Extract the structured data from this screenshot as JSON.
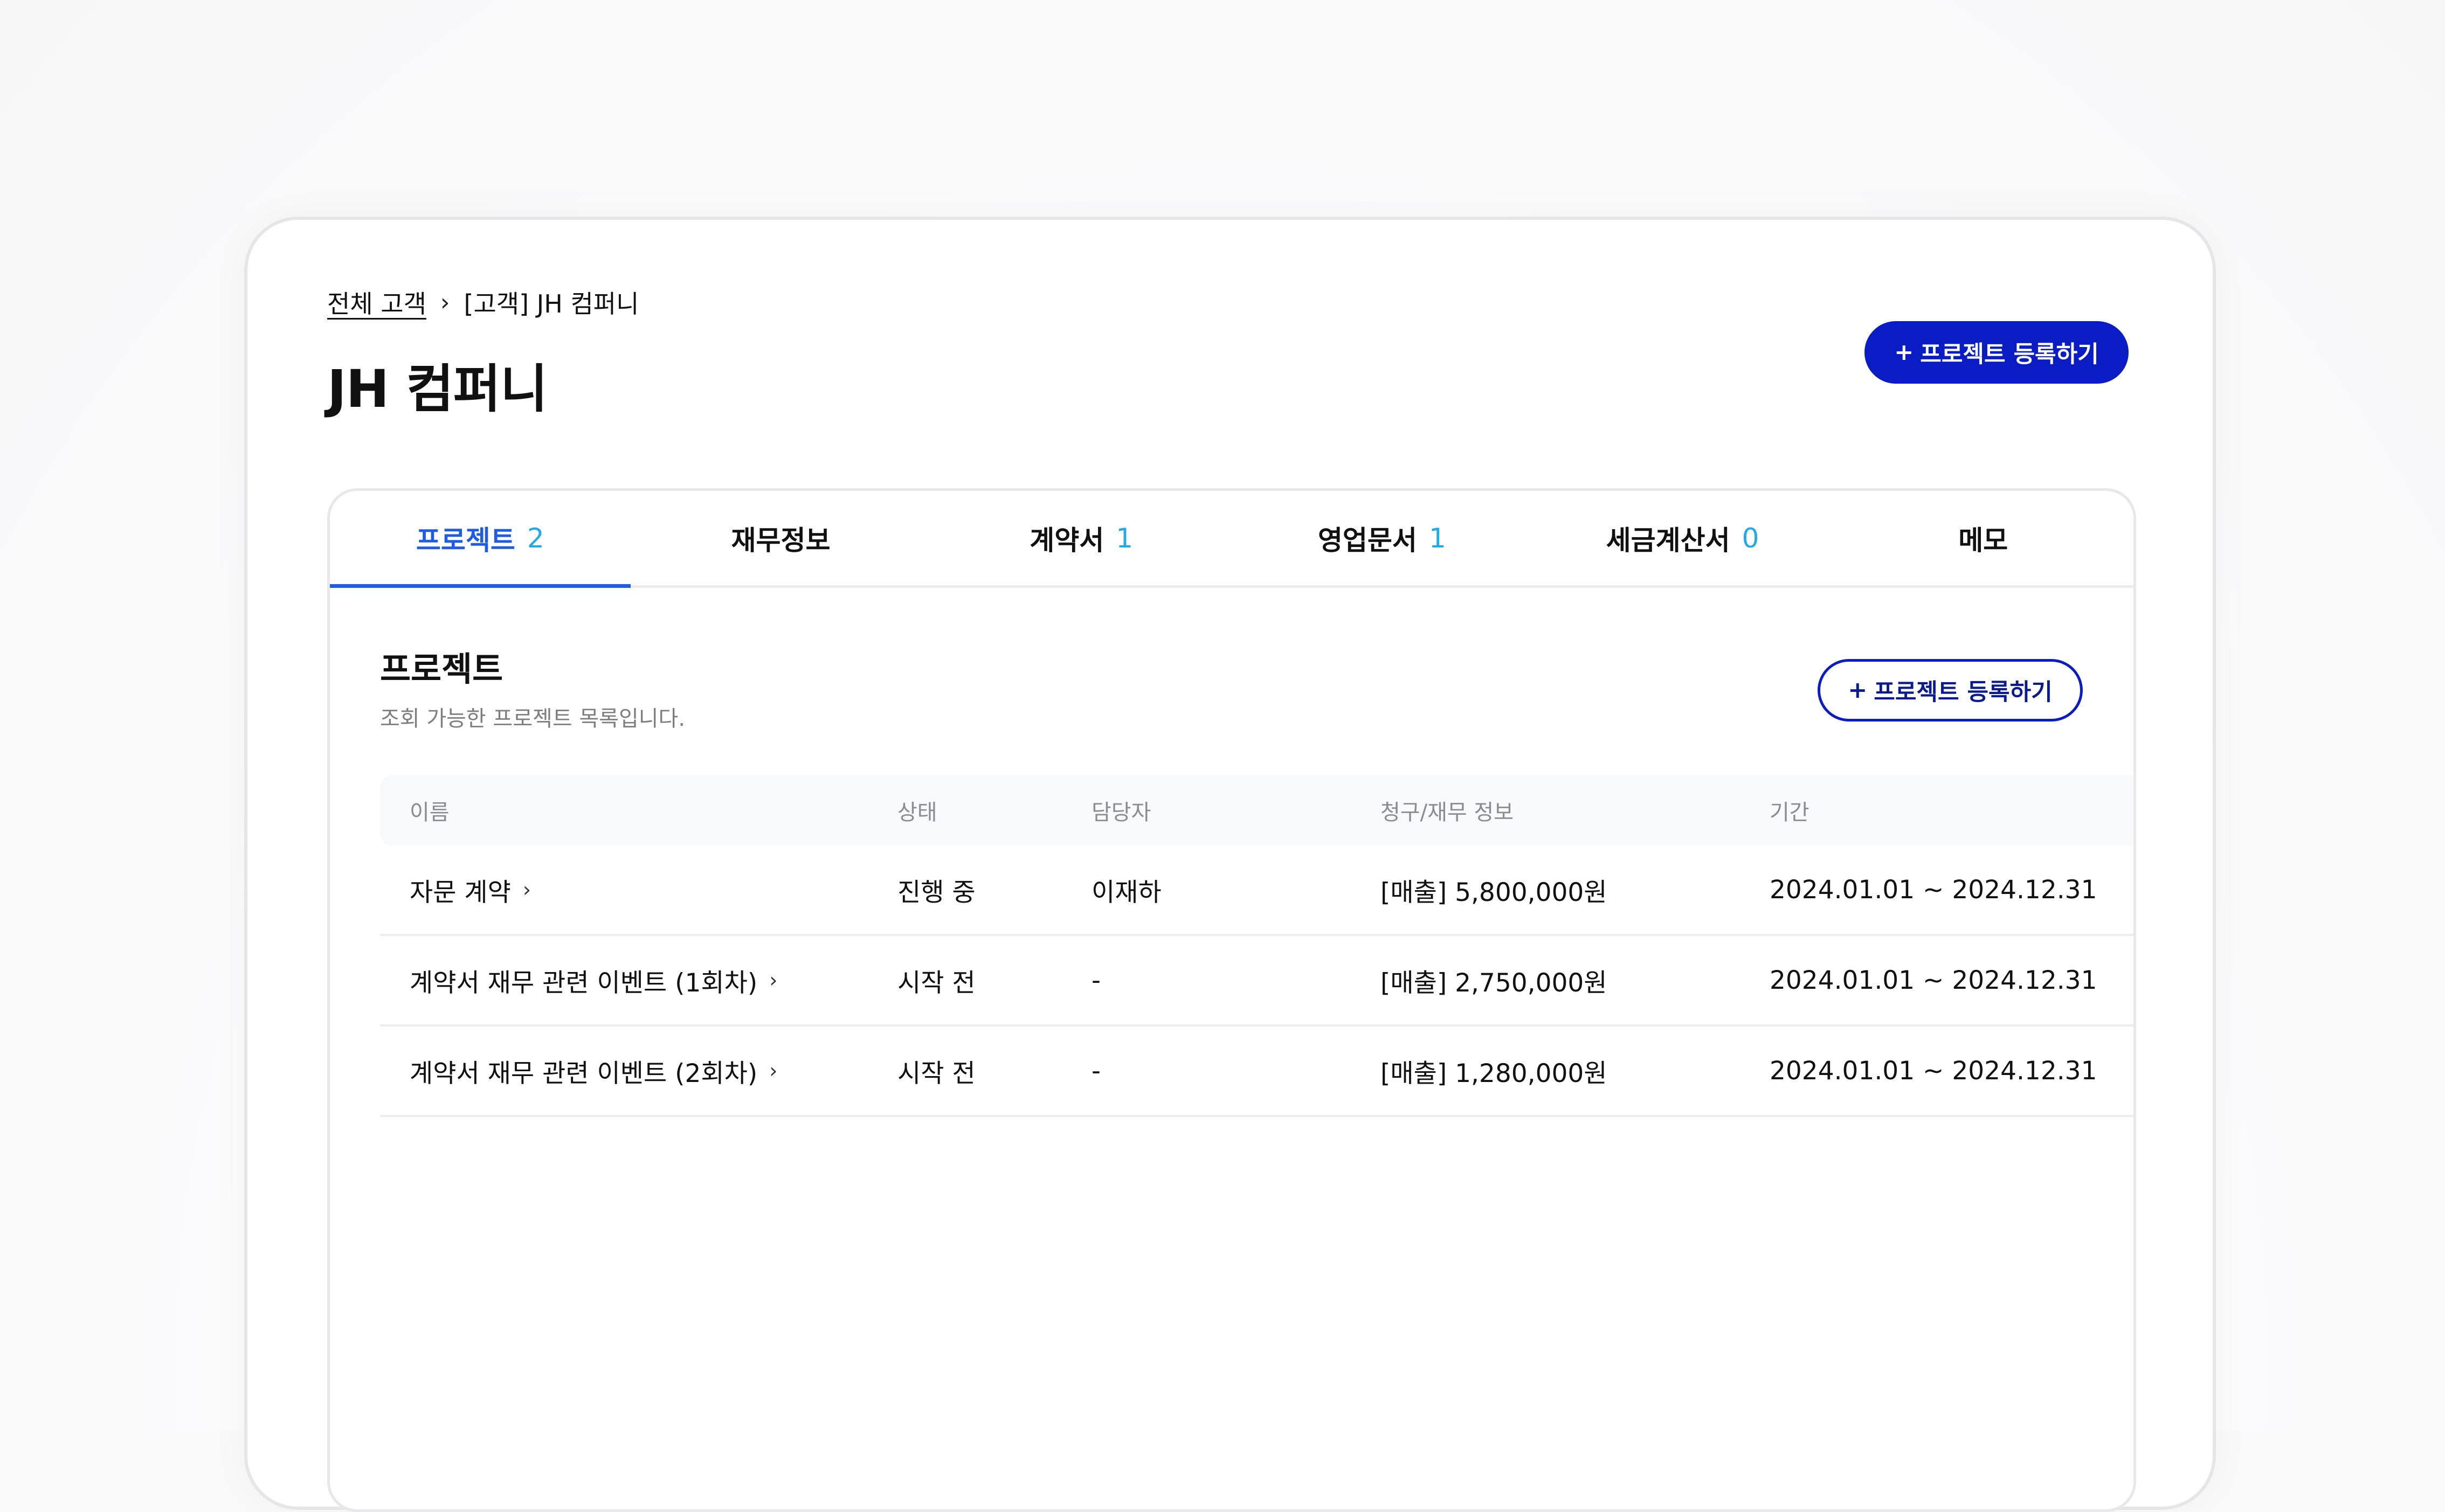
{
  "breadcrumb": {
    "parent": "전체 고객",
    "separator": "›",
    "current": "[고객] JH 컴퍼니"
  },
  "page": {
    "title": "JH 컴퍼니"
  },
  "header_action": {
    "plus": "+",
    "label": "프로젝트 등록하기"
  },
  "tabs": [
    {
      "label": "프로젝트",
      "count": "2",
      "active": true
    },
    {
      "label": "재무정보",
      "count": ""
    },
    {
      "label": "계약서",
      "count": "1"
    },
    {
      "label": "영업문서",
      "count": "1"
    },
    {
      "label": "세금계산서",
      "count": "0"
    },
    {
      "label": "메모",
      "count": ""
    }
  ],
  "section": {
    "title": "프로젝트",
    "description": "조회 가능한 프로젝트 목록입니다.",
    "action_plus": "+",
    "action_label": "프로젝트 등록하기"
  },
  "table": {
    "columns": {
      "name": "이름",
      "status": "상태",
      "owner": "담당자",
      "billing": "청구/재무 정보",
      "period": "기간"
    },
    "rows": [
      {
        "name": "자문 계약",
        "status": "진행 중",
        "owner": "이재하",
        "billing": "[매출] 5,800,000원",
        "period": "2024.01.01 ~ 2024.12.31"
      },
      {
        "name": "계약서 재무 관련 이벤트 (1회차)",
        "status": "시작 전",
        "owner": "-",
        "billing": "[매출] 2,750,000원",
        "period": "2024.01.01 ~ 2024.12.31"
      },
      {
        "name": "계약서 재무 관련 이벤트 (2회차)",
        "status": "시작 전",
        "owner": "-",
        "billing": "[매출] 1,280,000원",
        "period": "2024.01.01 ~ 2024.12.31"
      }
    ],
    "row_chevron": "›"
  },
  "colors": {
    "primary": "#0a1cc4",
    "active_tab": "#1f5ce6",
    "count": "#21a9e8"
  }
}
